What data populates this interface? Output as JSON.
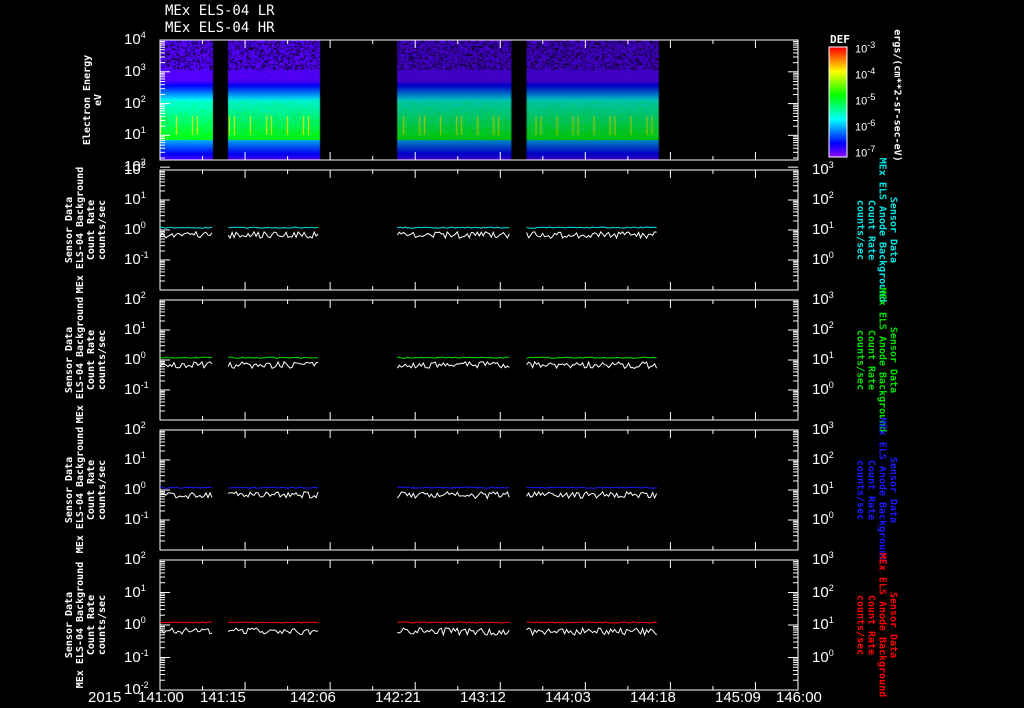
{
  "titles": [
    "MEx ELS-04 LR",
    "MEx ELS-04 HR"
  ],
  "colors": {
    "cyan": "#00e5e5",
    "green": "#00e000",
    "blue": "#1a1aff",
    "red": "#ff0000",
    "white": "#ffffff"
  },
  "chart_data": [
    {
      "type": "heatmap",
      "title": "Electron Energy spectrogram",
      "ylabel": "Electron Energy\neV",
      "yticks": [
        "10^4",
        "10^3",
        "10^2",
        "10^1",
        "10^2"
      ],
      "ylim_log": [
        0.3,
        4
      ],
      "colorbar": {
        "title": "DEF",
        "ticks": [
          "10^-3",
          "10^-4",
          "10^-5",
          "10^-6",
          "10^-7"
        ],
        "label": "ergs/(cm**2-sr-sec-eV)"
      },
      "data_segments": [
        [
          0,
          0.62
        ],
        [
          0.8,
          1.88
        ],
        [
          2.79,
          4.12
        ],
        [
          4.31,
          5.85
        ]
      ]
    },
    {
      "type": "line",
      "color_key": "cyan",
      "ylabel": "Sensor Data\nMEx ELS-04 Background\nCount Rate\ncounts/sec",
      "ylabel_right": "Sensor Data\nMEx ELS Anode Background\nCount Rate\ncounts/sec",
      "yticks": [
        "10^2",
        "10^1",
        "10^0",
        "10^-1"
      ],
      "yticks_right": [
        "10^3",
        "10^2",
        "10^1",
        "10^0"
      ],
      "series": [
        {
          "name": "background",
          "level": 1.2
        },
        {
          "name": "ELS-04",
          "level": 0.7
        }
      ]
    },
    {
      "type": "line",
      "color_key": "green",
      "ylabel": "Sensor Data\nMEx ELS-04 Background\nCount Rate\ncounts/sec",
      "ylabel_right": "Sensor Data\nMEx ELS Anode Background\nCount Rate\ncounts/sec",
      "yticks": [
        "10^2",
        "10^1",
        "10^0",
        "10^-1"
      ],
      "yticks_right": [
        "10^3",
        "10^2",
        "10^1",
        "10^0"
      ],
      "series": [
        {
          "name": "background",
          "level": 1.2
        },
        {
          "name": "ELS-04",
          "level": 0.7
        }
      ]
    },
    {
      "type": "line",
      "color_key": "blue",
      "ylabel": "Sensor Data\nMEx ELS-04 Background\nCount Rate\ncounts/sec",
      "ylabel_right": "Sensor Data\nMEx ELS Anode Background\nCount Rate\ncounts/sec",
      "yticks": [
        "10^2",
        "10^1",
        "10^0",
        "10^-1"
      ],
      "yticks_right": [
        "10^3",
        "10^2",
        "10^1",
        "10^0"
      ],
      "series": [
        {
          "name": "background",
          "level": 1.2
        },
        {
          "name": "ELS-04",
          "level": 0.7
        }
      ]
    },
    {
      "type": "line",
      "color_key": "red",
      "ylabel": "Sensor Data\nMEx ELS-04 Background\nCount Rate\ncounts/sec",
      "ylabel_right": "Sensor Data\nMEx ELS Anode Background\nCount Rate\ncounts/sec",
      "yticks": [
        "10^2",
        "10^1",
        "10^0",
        "10^-1",
        "10^-2"
      ],
      "yticks_right": [
        "10^3",
        "10^2",
        "10^1",
        "10^0"
      ],
      "series": [
        {
          "name": "background",
          "level": 1.2
        },
        {
          "name": "ELS-04",
          "level": 0.65
        }
      ]
    }
  ],
  "xaxis": {
    "year": "2015",
    "ticks": [
      "141:00",
      "141:15",
      "142:06",
      "142:21",
      "143:12",
      "144:03",
      "144:18",
      "145:09",
      "146:00"
    ],
    "range": [
      0,
      7.5
    ]
  }
}
